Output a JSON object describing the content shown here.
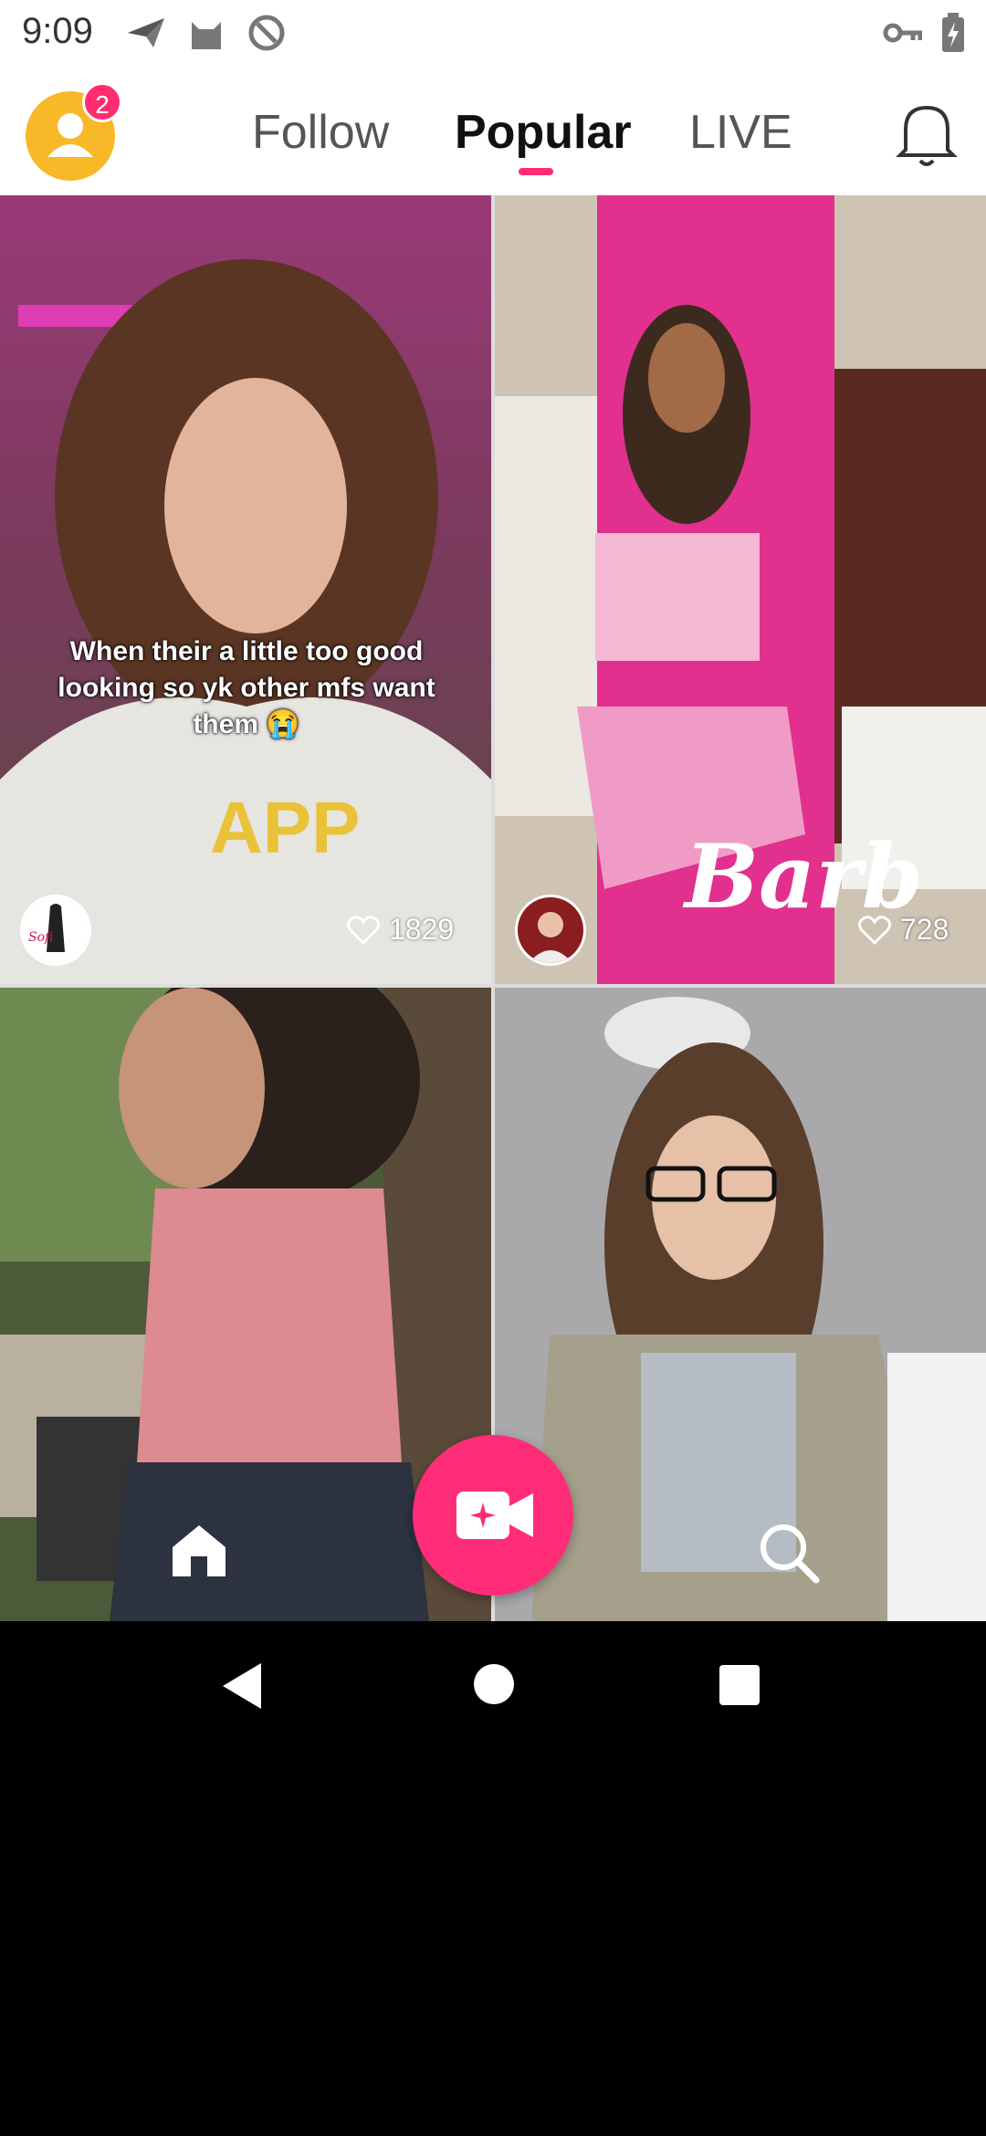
{
  "status_bar": {
    "time": "9:09",
    "icons": [
      "paper-plane-icon",
      "cat-icon",
      "at-sign-icon",
      "key-icon",
      "battery-charging-icon"
    ]
  },
  "header": {
    "notification_count": "2",
    "tabs": [
      {
        "label": "Follow",
        "active": false
      },
      {
        "label": "Popular",
        "active": true
      },
      {
        "label": "LIVE",
        "active": false
      }
    ],
    "bell_icon": "bell-icon",
    "accent_color": "#ff2d6f"
  },
  "feed": {
    "cards": [
      {
        "caption": "When their a little too good looking so yk other mfs want them 😭",
        "likes": "1829"
      },
      {
        "caption": "",
        "likes": "728",
        "overlay_text": "Barb"
      },
      {
        "caption": "",
        "likes": ""
      },
      {
        "caption": "",
        "likes": ""
      }
    ]
  },
  "bottom_nav": {
    "items": [
      "home-icon",
      "record-video-icon",
      "search-icon"
    ]
  },
  "system_nav": {
    "items": [
      "back-icon",
      "home-circle-icon",
      "recents-icon"
    ]
  }
}
